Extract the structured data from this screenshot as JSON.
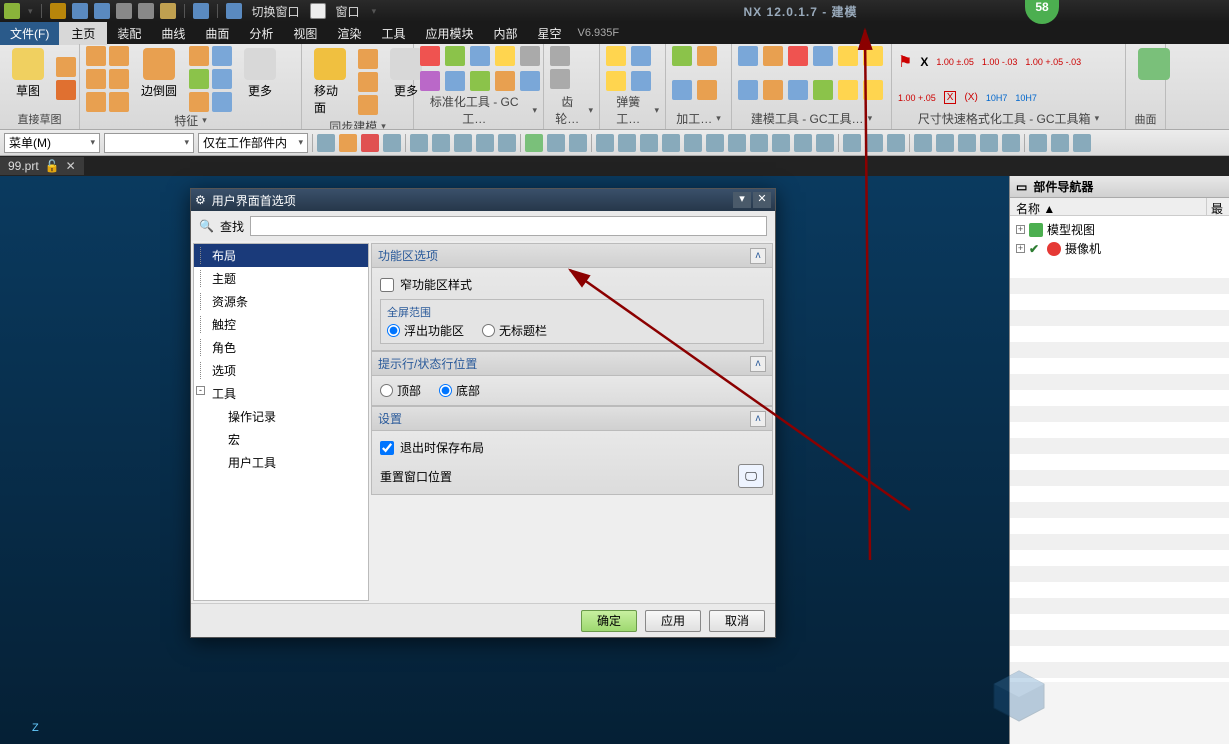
{
  "titlebar": {
    "switch_window": "切换窗口",
    "window": "窗口",
    "app_title": "NX 12.0.1.7 - 建模",
    "badge": "58"
  },
  "menu": {
    "file": "文件(F)",
    "home": "主页",
    "items": [
      "装配",
      "曲线",
      "曲面",
      "分析",
      "视图",
      "渲染",
      "工具",
      "应用模块",
      "内部",
      "星空"
    ],
    "extra": "V6.935F"
  },
  "ribbon": {
    "g0": "直接草图",
    "g0a": "草图",
    "g1": "特征",
    "g1_btn1": "边倒圆",
    "g1_btn2": "更多",
    "g2": "同步建模",
    "g2_btn1": "移动面",
    "g2_btn2": "更多",
    "g3": "标准化工具 - GC工…",
    "g4": "齿轮… ",
    "g5": "弹簧工…",
    "g6": "加工…",
    "g7": "建模工具 - GC工具…",
    "g8": "尺寸快速格式化工具 - GC工具箱",
    "g9": "曲面",
    "dim_x": "X",
    "dim_labels": [
      "1.00 ±.05",
      "1.00 -.03",
      "1.00 +.05 -.03",
      "1.00 +.05",
      "10H7",
      "10H7"
    ]
  },
  "selbar": {
    "menu_label": "菜单(M)",
    "filter": "仅在工作部件内"
  },
  "filetab": {
    "name": "99.prt",
    "mod": "🔒"
  },
  "rightpanel": {
    "title": "部件导航器",
    "col1": "名称",
    "col2": "最",
    "node1": "模型视图",
    "node2": "摄像机"
  },
  "dialog": {
    "title": "用户界面首选项",
    "search_label": "查找",
    "nav": {
      "layout": "布局",
      "theme": "主题",
      "resource": "资源条",
      "touch": "触控",
      "role": "角色",
      "options": "选项",
      "tools": "工具",
      "history": "操作记录",
      "macro": "宏",
      "usertools": "用户工具"
    },
    "sec1": {
      "title": "功能区选项",
      "narrow": "窄功能区样式",
      "fullscreen_grp": "全屏范围",
      "float_ribbon": "浮出功能区",
      "no_titlebar": "无标题栏"
    },
    "sec2": {
      "title": "提示行/状态行位置",
      "top": "顶部",
      "bottom": "底部"
    },
    "sec3": {
      "title": "设置",
      "save_on_exit": "退出时保存布局",
      "reset_pos": "重置窗口位置"
    },
    "btn_ok": "确定",
    "btn_apply": "应用",
    "btn_cancel": "取消"
  }
}
